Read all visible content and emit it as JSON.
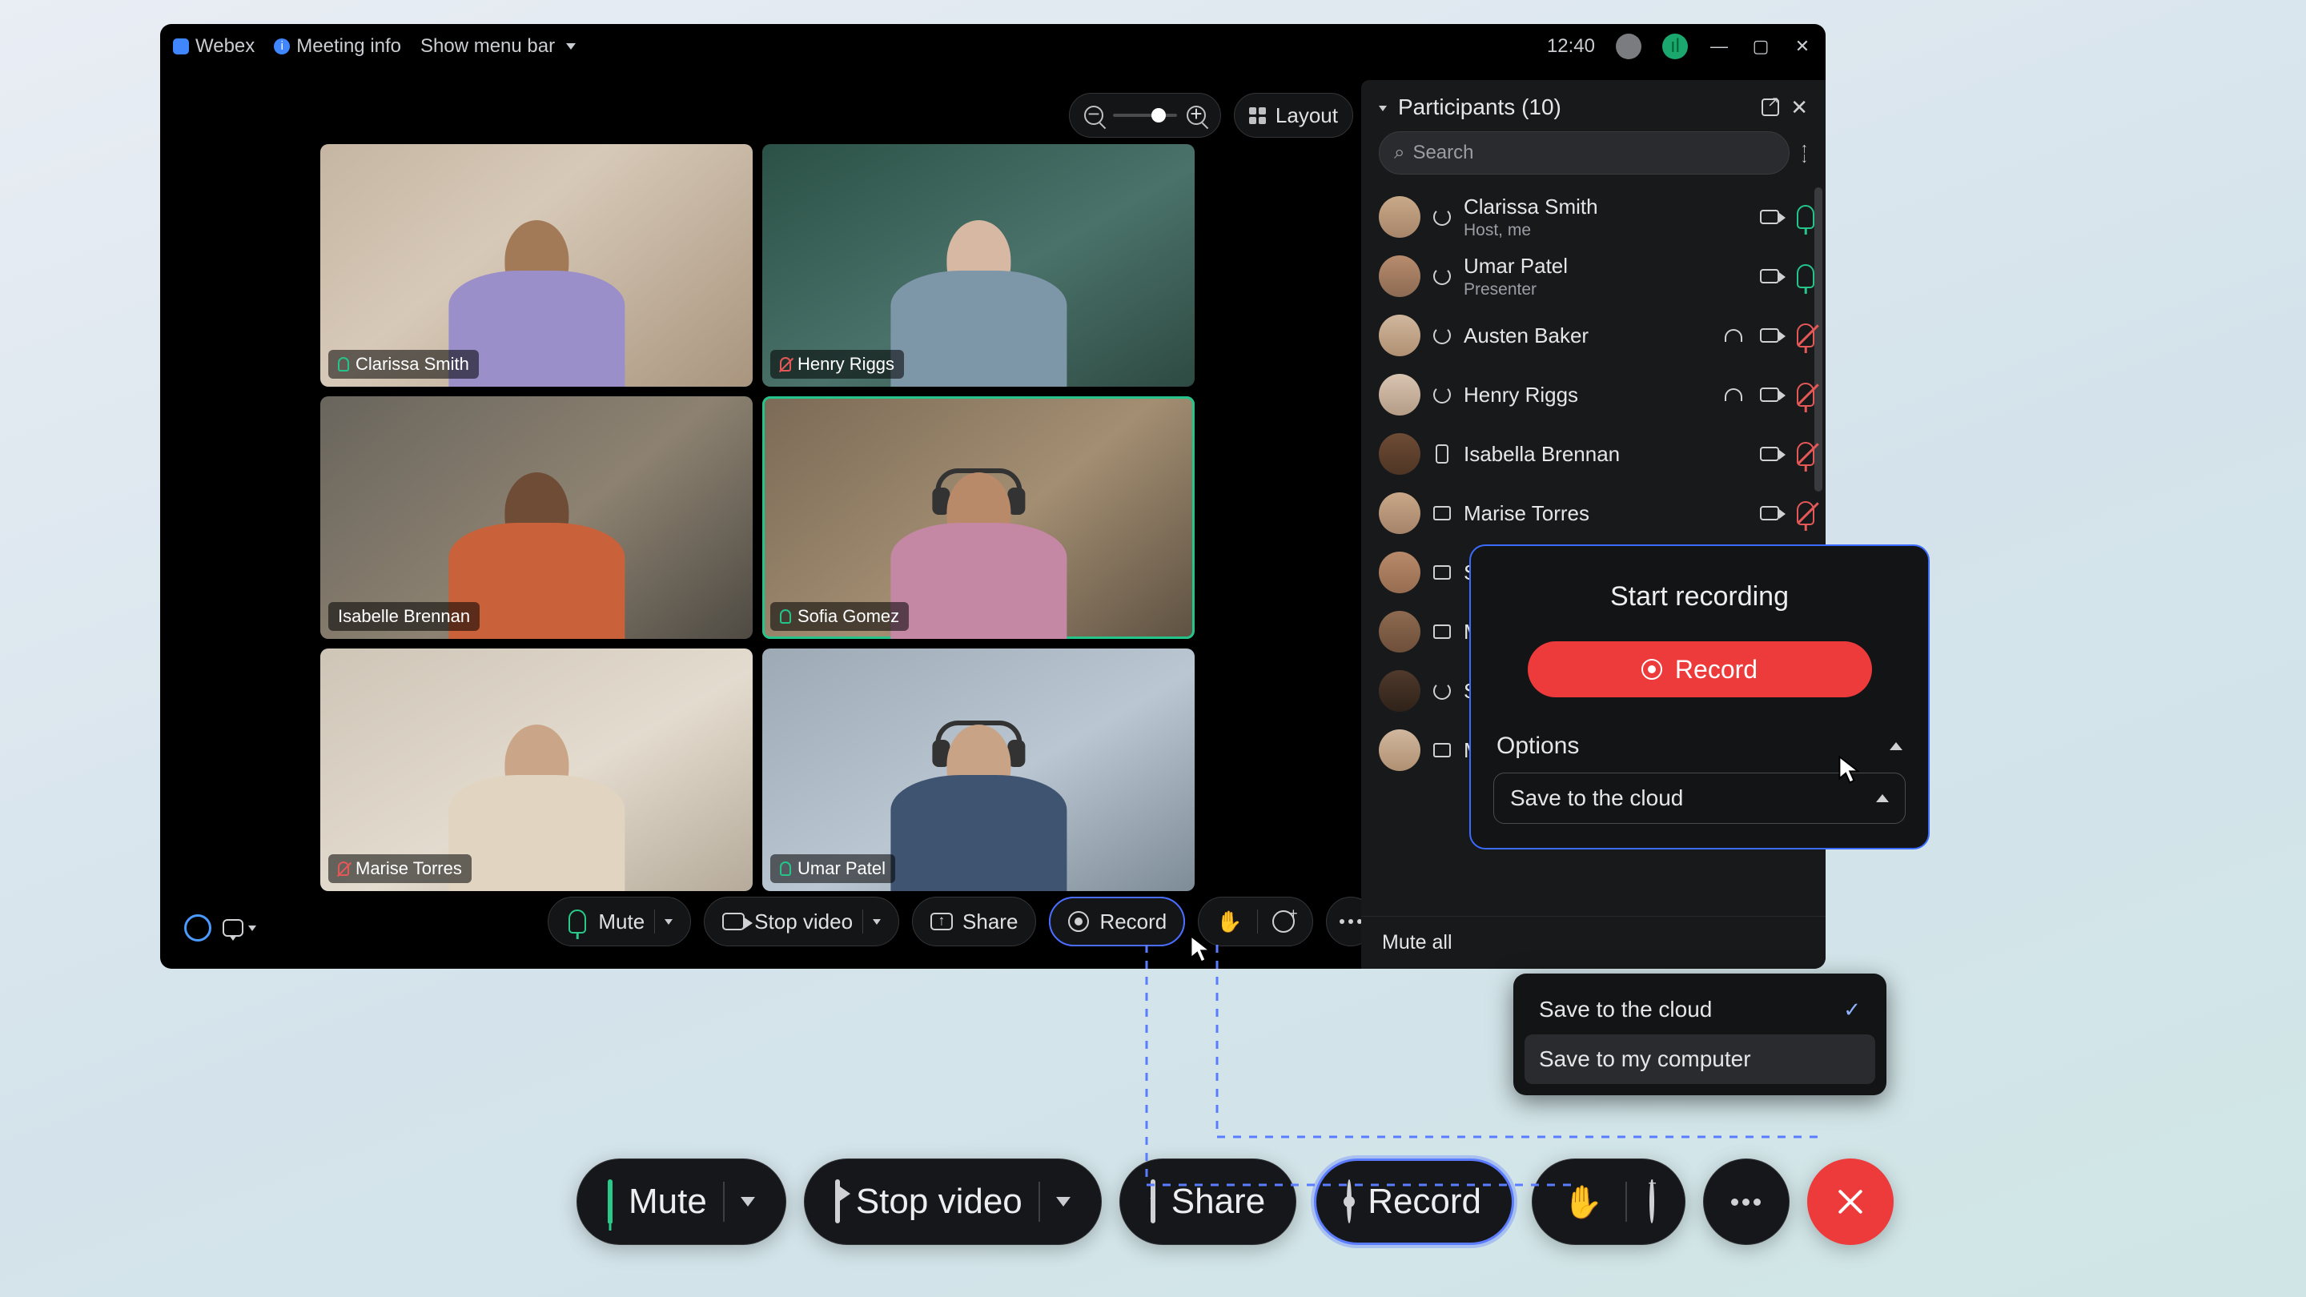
{
  "titlebar": {
    "app": "Webex",
    "meeting_info": "Meeting info",
    "show_menu": "Show menu bar",
    "clock": "12:40"
  },
  "viewbar": {
    "layout_label": "Layout"
  },
  "tiles": [
    {
      "name": "Clarissa Smith",
      "muted": false,
      "active": false
    },
    {
      "name": "Henry Riggs",
      "muted": true,
      "active": false
    },
    {
      "name": "Isabelle Brennan",
      "muted": false,
      "active": false
    },
    {
      "name": "Sofia Gomez",
      "muted": false,
      "active": true
    },
    {
      "name": "Marise Torres",
      "muted": true,
      "active": false
    },
    {
      "name": "Umar Patel",
      "muted": false,
      "active": false
    }
  ],
  "controls": {
    "mute": "Mute",
    "stop_video": "Stop video",
    "share": "Share",
    "record": "Record"
  },
  "big_controls": {
    "mute": "Mute",
    "stop_video": "Stop video",
    "share": "Share",
    "record": "Record"
  },
  "panel": {
    "title": "Participants (10)",
    "search_placeholder": "Search",
    "mute_all": "Mute all",
    "rows": [
      {
        "name": "Clarissa Smith",
        "role": "Host, me",
        "badge": "loop",
        "mic": "on",
        "cam": true,
        "head": false
      },
      {
        "name": "Umar Patel",
        "role": "Presenter",
        "badge": "loop",
        "mic": "on",
        "cam": true,
        "head": false
      },
      {
        "name": "Austen Baker",
        "role": "",
        "badge": "loop",
        "mic": "muted",
        "cam": true,
        "head": true
      },
      {
        "name": "Henry Riggs",
        "role": "",
        "badge": "loop",
        "mic": "muted",
        "cam": true,
        "head": true
      },
      {
        "name": "Isabella Brennan",
        "role": "",
        "badge": "device",
        "mic": "muted",
        "cam": true,
        "head": false
      },
      {
        "name": "Marise Torres",
        "role": "",
        "badge": "screen",
        "mic": "muted",
        "cam": true,
        "head": false
      },
      {
        "name": "Sof",
        "role": "",
        "badge": "screen",
        "mic": "",
        "cam": false,
        "head": false
      },
      {
        "name": "Mu",
        "role": "",
        "badge": "screen",
        "mic": "",
        "cam": false,
        "head": false
      },
      {
        "name": "Sor",
        "role": "",
        "badge": "loop",
        "mic": "",
        "cam": false,
        "head": false
      },
      {
        "name": "Ma",
        "role": "",
        "badge": "screen",
        "mic": "",
        "cam": false,
        "head": false
      }
    ]
  },
  "popup": {
    "title": "Start recording",
    "record": "Record",
    "options": "Options",
    "selected": "Save to the cloud",
    "menu": [
      "Save to the cloud",
      "Save to my computer"
    ]
  }
}
